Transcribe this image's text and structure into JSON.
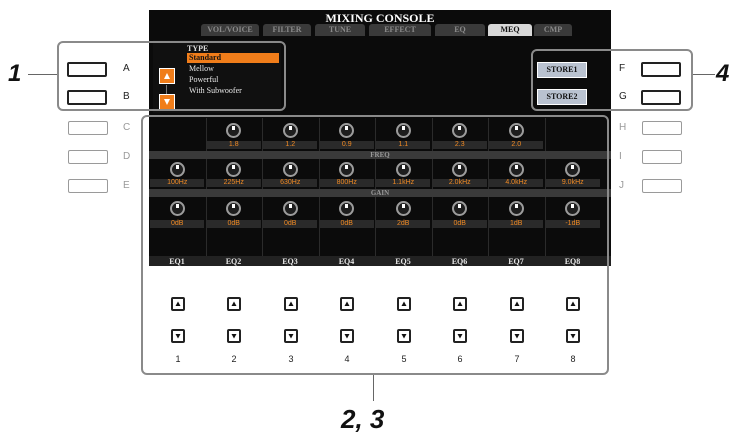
{
  "screen": {
    "title": "MIXING CONSOLE",
    "tabs": [
      {
        "label": "VOL/VOICE",
        "active": false
      },
      {
        "label": "FILTER",
        "active": false
      },
      {
        "label": "TUNE",
        "active": false
      },
      {
        "label": "EFFECT",
        "active": false
      },
      {
        "label": "EQ",
        "active": false
      },
      {
        "label": "MEQ",
        "active": true
      },
      {
        "label": "CMP",
        "active": false
      }
    ],
    "type_panel": {
      "heading": "TYPE",
      "items": [
        "Standard",
        "Mellow",
        "Powerful",
        "With Subwoofer"
      ],
      "selected_index": 0
    },
    "store_buttons": [
      "STORE1",
      "STORE2"
    ],
    "row_labels": {
      "freq": "FREQ",
      "gain": "GAIN"
    },
    "q_values": [
      "",
      "1.8",
      "1.2",
      "0.9",
      "1.1",
      "2.3",
      "2.0",
      ""
    ],
    "freq_values": [
      "100Hz",
      "225Hz",
      "630Hz",
      "800Hz",
      "1.1kHz",
      "2.0kHz",
      "4.0kHz",
      "9.0kHz"
    ],
    "gain_values": [
      "0dB",
      "0dB",
      "0dB",
      "0dB",
      "2dB",
      "0dB",
      "1dB",
      "-1dB"
    ],
    "eq_labels": [
      "EQ1",
      "EQ2",
      "EQ3",
      "EQ4",
      "EQ5",
      "EQ6",
      "EQ7",
      "EQ8"
    ],
    "accent_color": "#f07d1a"
  },
  "panel": {
    "left_letters": [
      "A",
      "B",
      "C",
      "D",
      "E"
    ],
    "right_letters": [
      "F",
      "G",
      "H",
      "I",
      "J"
    ],
    "numbers": [
      "1",
      "2",
      "3",
      "4",
      "5",
      "6",
      "7",
      "8"
    ]
  },
  "callouts": {
    "left": "1",
    "right": "4",
    "bottom": "2, 3"
  }
}
